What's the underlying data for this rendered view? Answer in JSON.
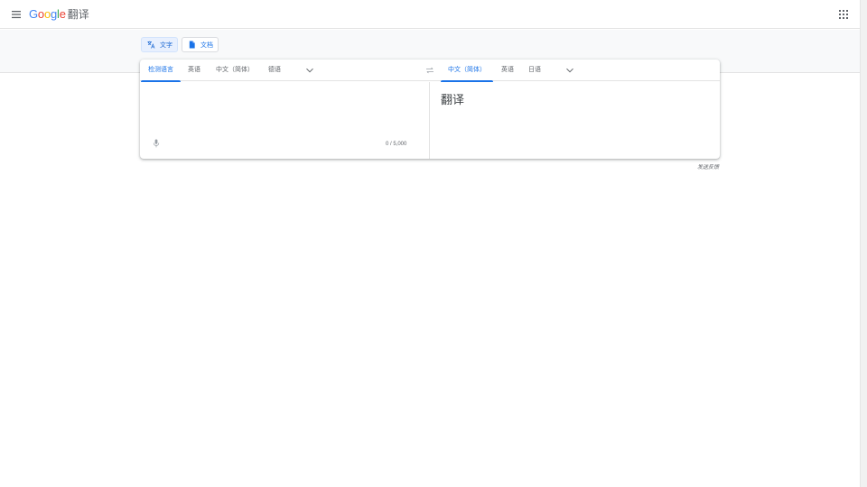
{
  "header": {
    "logo_letters": [
      "G",
      "o",
      "o",
      "g",
      "l",
      "e"
    ],
    "product_name": "翻译",
    "icons": {
      "menu": "hamburger-menu-icon",
      "apps": "apps-grid-icon"
    }
  },
  "modes": {
    "text_label": "文字",
    "documents_label": "文档",
    "active": "text"
  },
  "source": {
    "languages": [
      "检测语言",
      "英语",
      "中文（简体）",
      "德语"
    ],
    "selected": "检测语言",
    "input_value": "",
    "char_counter": "0 / 5,000"
  },
  "target": {
    "languages": [
      "中文（简体）",
      "英语",
      "日语"
    ],
    "selected": "中文（简体）",
    "output_text": "翻译"
  },
  "feedback_label": "发送反馈",
  "colors": {
    "accent": "#1a73e8",
    "band_background": "#f8f9fa",
    "google_blue": "#4285f4",
    "google_red": "#ea4335",
    "google_yellow": "#fbbc05",
    "google_green": "#34a853"
  }
}
